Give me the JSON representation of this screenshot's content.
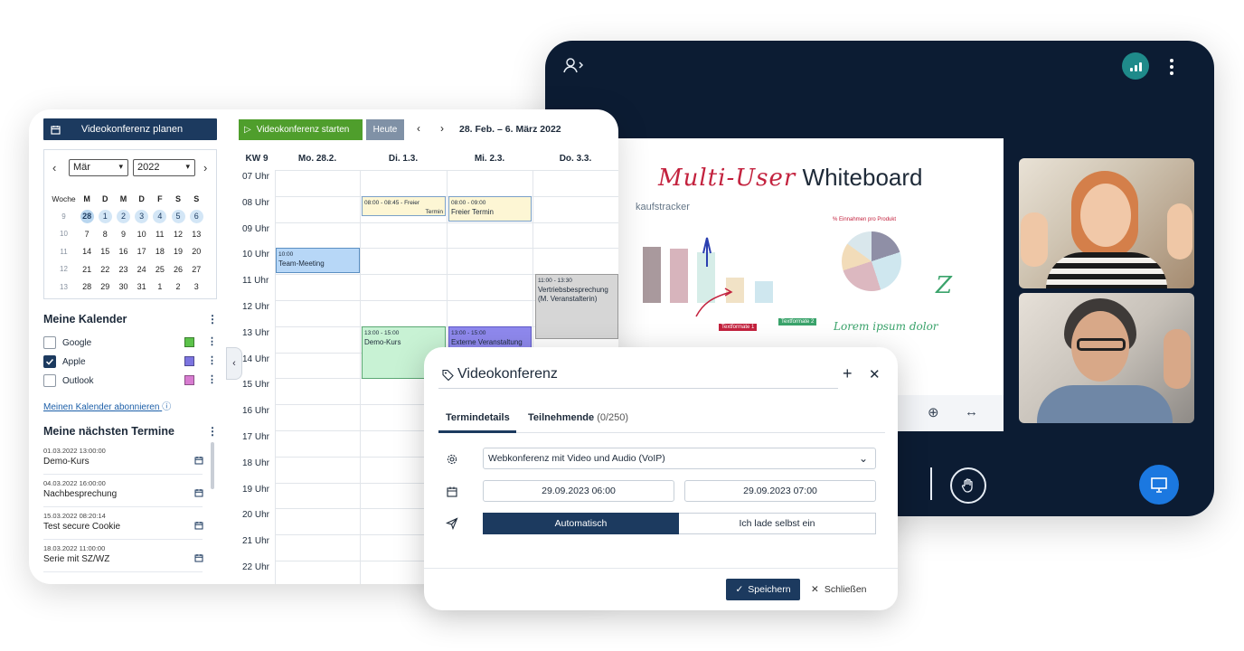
{
  "video": {
    "whiteboard_title_hand": "Multi-User",
    "whiteboard_title": "Whiteboard",
    "whiteboard_subtitle": "kaufstracker",
    "whiteboard_ink": "Lorem ipsum dolor",
    "whiteboard_tag_a": "Textformate 1",
    "whiteboard_tag_b": "Textformate 2",
    "pie_label": "% Einnahmen pro Produkt",
    "brand_color": "#0c1c33",
    "accent_color": "#1b78e0"
  },
  "calendar": {
    "plan_button": "Videokonferenz planen",
    "mini": {
      "month": "Mär",
      "year": "2022",
      "prev": "‹",
      "next": "›",
      "head": [
        "Woche",
        "M",
        "D",
        "M",
        "D",
        "F",
        "S",
        "S"
      ],
      "weeks": [
        {
          "kw": "9",
          "days": [
            "28",
            "1",
            "2",
            "3",
            "4",
            "5",
            "6"
          ]
        },
        {
          "kw": "10",
          "days": [
            "7",
            "8",
            "9",
            "10",
            "11",
            "12",
            "13"
          ]
        },
        {
          "kw": "11",
          "days": [
            "14",
            "15",
            "16",
            "17",
            "18",
            "19",
            "20"
          ]
        },
        {
          "kw": "12",
          "days": [
            "21",
            "22",
            "23",
            "24",
            "25",
            "26",
            "27"
          ]
        },
        {
          "kw": "13",
          "days": [
            "28",
            "29",
            "30",
            "31",
            "1",
            "2",
            "3"
          ]
        }
      ]
    },
    "my_calendars_title": "Meine Kalender",
    "calendars": [
      {
        "label": "Google",
        "checked": false,
        "color": "#5cc24a"
      },
      {
        "label": "Apple",
        "checked": true,
        "color": "#7c74e0"
      },
      {
        "label": "Outlook",
        "checked": false,
        "color": "#d77bd0"
      }
    ],
    "subscribe_link": "Meinen Kalender abonnieren",
    "next_title": "Meine nächsten Termine",
    "appointments": [
      {
        "date": "01.03.2022 13:00:00",
        "title": "Demo-Kurs"
      },
      {
        "date": "04.03.2022 16:00:00",
        "title": "Nachbesprechung"
      },
      {
        "date": "15.03.2022 08:20:14",
        "title": "Test secure Cookie"
      },
      {
        "date": "18.03.2022 11:00:00",
        "title": "Serie mit SZ/WZ"
      }
    ],
    "start_button": "Videokonferenz starten",
    "today_button": "Heute",
    "range": "28. Feb. – 6. März 2022",
    "week_label": "KW 9",
    "days": [
      "Mo. 28.2.",
      "Di. 1.3.",
      "Mi. 2.3.",
      "Do. 3.3."
    ],
    "hours": [
      "07 Uhr",
      "08 Uhr",
      "09 Uhr",
      "10 Uhr",
      "11 Uhr",
      "12 Uhr",
      "13 Uhr",
      "14 Uhr",
      "15 Uhr",
      "16 Uhr",
      "17 Uhr",
      "18 Uhr",
      "19 Uhr",
      "20 Uhr",
      "21 Uhr",
      "22 Uhr"
    ],
    "events": {
      "e1_time": "08:00 - 08:45 - Freier",
      "e1_title": "Termin",
      "e2_time": "08:00 - 09:00",
      "e2_title": "Freier Termin",
      "e3_time": "10:00",
      "e3_title": "Team-Meeting",
      "e4_time": "11:00 - 13:30",
      "e4_title": "Vertriebsbesprechung (M. Veranstalterin)",
      "e5_time": "13:00 - 15:00",
      "e5_title": "Demo-Kurs",
      "e6_time": "13:00 - 15:00",
      "e6_title": "Externe Veranstaltung"
    }
  },
  "modal": {
    "title": "Videokonferenz",
    "tab_details": "Termindetails",
    "tab_participants": "Teilnehmende",
    "participant_count": "(0/250)",
    "conference_type": "Webkonferenz mit Video und Audio (VoIP)",
    "start": "29.09.2023 06:00",
    "end": "29.09.2023 07:00",
    "mode_auto": "Automatisch",
    "mode_self": "Ich lade selbst ein",
    "save": "Speichern",
    "close": "Schließen"
  }
}
